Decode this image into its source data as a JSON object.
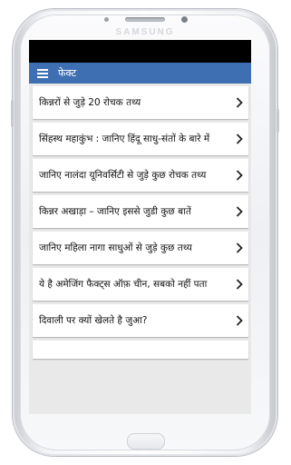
{
  "device": {
    "brand": "SAMSUNG"
  },
  "appbar": {
    "title": "फेक्ट",
    "menu_icon": "hamburger-menu-icon",
    "color": "#3f6fb3"
  },
  "list": {
    "items": [
      {
        "label": "किन्नरों से जुड़े 20 रोचक तथ्य"
      },
      {
        "label": "सिंहस्थ महाकुंभ : जानिए हिंदू साधु-संतों के बारे में"
      },
      {
        "label": "जानिए नालंदा यूनिवर्सिटी से जुड़े कुछ रोचक तथ्य"
      },
      {
        "label": "किन्नर अखाड़ा – जानिए इससे जुडी कुछ बातें"
      },
      {
        "label": "जानिए महिला नागा साधुओं से जुड़े कुछ तथ्य"
      },
      {
        "label": "ये है अमेजिंग फैक्ट्स ऑफ़ चीन, सबको नहीं पता"
      },
      {
        "label": "दिवाली पर क्यों खेलते है जुआ?"
      }
    ],
    "chevron_icon": "chevron-right-icon"
  }
}
